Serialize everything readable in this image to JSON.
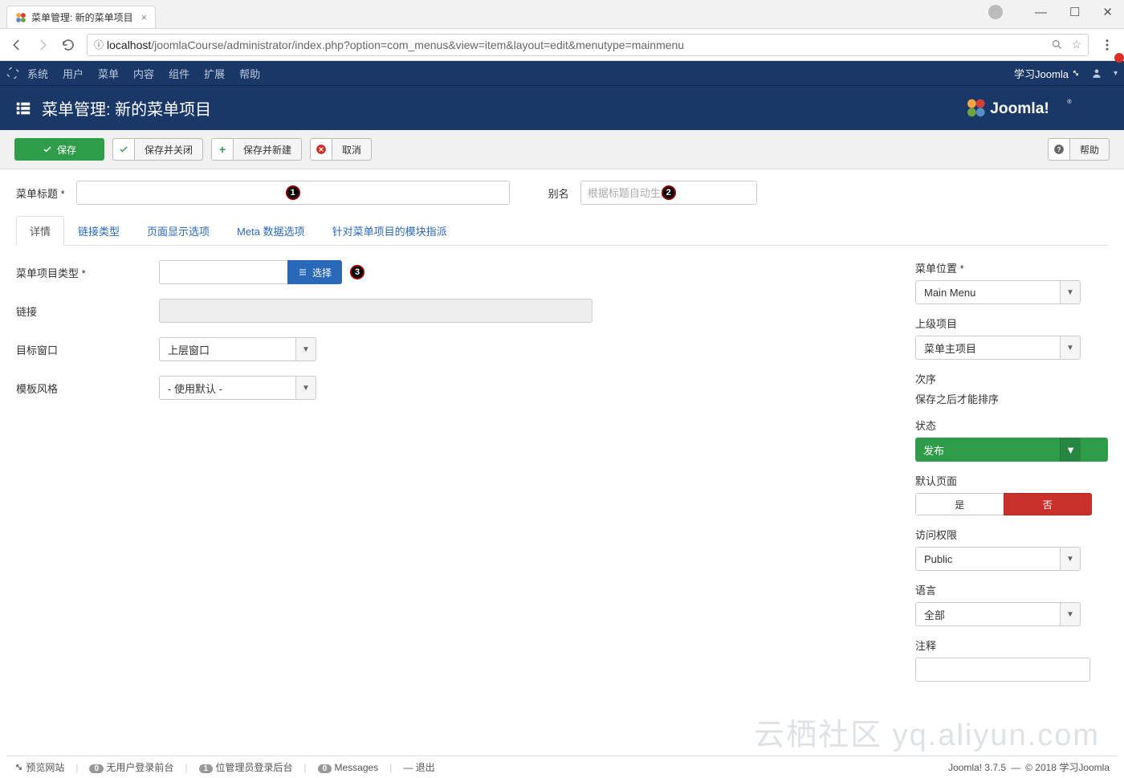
{
  "browser": {
    "tab_title": "菜单管理: 新的菜单项目",
    "url_host": "localhost",
    "url_path": "/joomlaCourse/administrator/index.php?option=com_menus&view=item&layout=edit&menutype=mainmenu"
  },
  "topbar": {
    "items": [
      "系统",
      "用户",
      "菜单",
      "内容",
      "组件",
      "扩展",
      "帮助"
    ],
    "site_link": "学习Joomla"
  },
  "page_title": "菜单管理: 新的菜单项目",
  "toolbar": {
    "save": "保存",
    "save_close": "保存并关闭",
    "save_new": "保存并新建",
    "cancel": "取消",
    "help": "帮助"
  },
  "fields": {
    "title_label": "菜单标题 *",
    "title_value": "",
    "alias_label": "别名",
    "alias_placeholder": "根据标题自动生成",
    "alias_value": ""
  },
  "tabs": [
    "详情",
    "链接类型",
    "页面显示选项",
    "Meta 数据选项",
    "针对菜单项目的模块指派"
  ],
  "left": {
    "type_label": "菜单项目类型 *",
    "type_value": "",
    "select_btn": "选择",
    "link_label": "链接",
    "link_value": "",
    "target_label": "目标窗口",
    "target_value": "上层窗口",
    "style_label": "模板风格",
    "style_value": "- 使用默认 -"
  },
  "right": {
    "menu_loc_label": "菜单位置 *",
    "menu_loc_value": "Main Menu",
    "parent_label": "上级项目",
    "parent_value": "菜单主项目",
    "order_label": "次序",
    "order_note": "保存之后才能排序",
    "status_label": "状态",
    "status_value": "发布",
    "default_label": "默认页面",
    "default_yes": "是",
    "default_no": "否",
    "access_label": "访问权限",
    "access_value": "Public",
    "lang_label": "语言",
    "lang_value": "全部",
    "note_label": "注释",
    "note_value": ""
  },
  "status": {
    "preview": "预览网站",
    "visitors_count": "0",
    "visitors_text": "无用户登录前台",
    "admins_count": "1",
    "admins_text": "位管理员登录后台",
    "msgs_count": "0",
    "msgs_text": "Messages",
    "logout": "退出",
    "version": "Joomla! 3.7.5",
    "copyright": "© 2018 学习Joomla"
  },
  "watermark": "云栖社区 yq.aliyun.com",
  "badges": {
    "b1": "1",
    "b2": "2",
    "b3": "3"
  }
}
